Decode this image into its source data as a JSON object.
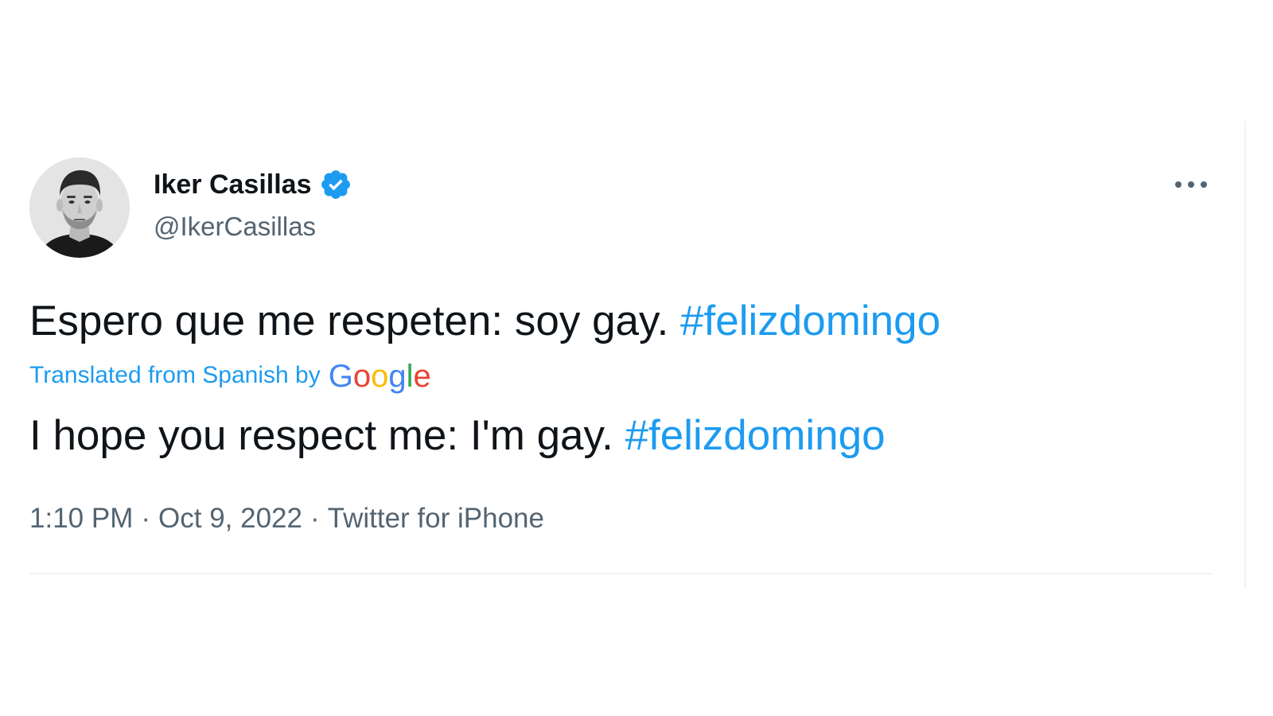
{
  "author": {
    "display_name": "Iker Casillas",
    "handle": "@IkerCasillas",
    "verified": true,
    "avatar_icon": "profile-photo"
  },
  "tweet": {
    "original_text": "Espero que me respeten: soy gay.",
    "original_hashtag": "#felizdomingo",
    "translation_label": "Translated from Spanish by",
    "translation_provider": "Google",
    "translated_text": "I hope you respect me: I'm gay.",
    "translated_hashtag": "#felizdomingo"
  },
  "meta": {
    "time": "1:10 PM",
    "date": "Oct 9, 2022",
    "source": "Twitter for iPhone",
    "separator": "·"
  },
  "icons": {
    "more": "more-options-icon",
    "verified": "verified-badge-icon"
  },
  "colors": {
    "link": "#1d9bf0",
    "text": "#0f1419",
    "secondary": "#536471",
    "divider": "#eff3f4",
    "google_blue": "#4285f4",
    "google_red": "#ea4335",
    "google_yellow": "#fbbc05",
    "google_green": "#34a853"
  }
}
